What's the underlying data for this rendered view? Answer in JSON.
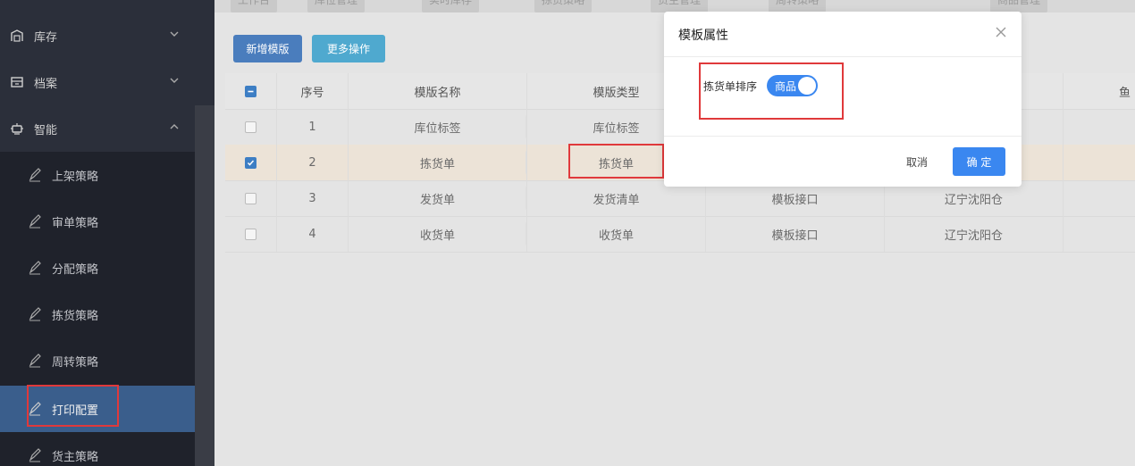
{
  "sidebar": {
    "groups": [
      {
        "label": "库存",
        "icon": "warehouse-icon"
      },
      {
        "label": "档案",
        "icon": "archive-icon"
      },
      {
        "label": "智能",
        "icon": "robot-icon"
      }
    ],
    "items": [
      {
        "label": "上架策略",
        "icon": "edit-icon"
      },
      {
        "label": "审单策略",
        "icon": "edit-icon"
      },
      {
        "label": "分配策略",
        "icon": "edit-icon"
      },
      {
        "label": "拣货策略",
        "icon": "edit-icon"
      },
      {
        "label": "周转策略",
        "icon": "edit-icon"
      },
      {
        "label": "打印配置",
        "icon": "edit-icon",
        "active": true
      },
      {
        "label": "货主策略",
        "icon": "edit-icon"
      }
    ]
  },
  "tabs": [
    "工作台",
    "库位管理",
    "实时库存",
    "拣货策略",
    "货主管理",
    "周转策略",
    "商品管理"
  ],
  "toolbar": {
    "add_label": "新增模版",
    "more_label": "更多操作"
  },
  "table": {
    "headers": [
      "序号",
      "模版名称",
      "模版类型",
      "",
      "",
      "鱼"
    ],
    "rows": [
      {
        "no": "1",
        "name": "库位标签",
        "type": "库位标签",
        "c4": "",
        "c5": "",
        "checked": false
      },
      {
        "no": "2",
        "name": "拣货单",
        "type": "拣货单",
        "c4": "",
        "c5": "",
        "checked": true
      },
      {
        "no": "3",
        "name": "发货单",
        "type": "发货清单",
        "c4": "模板接口",
        "c5": "辽宁沈阳仓",
        "checked": false
      },
      {
        "no": "4",
        "name": "收货单",
        "type": "收货单",
        "c4": "模板接口",
        "c5": "辽宁沈阳仓",
        "checked": false
      }
    ]
  },
  "modal": {
    "title": "模板属性",
    "field_label": "拣货单排序",
    "switch_text": "商品",
    "switch_on": true,
    "cancel_label": "取消",
    "ok_label": "确 定"
  },
  "colors": {
    "primary": "#3a87f0",
    "highlight": "#e0393b",
    "sidebar": "#2b2f3a"
  }
}
